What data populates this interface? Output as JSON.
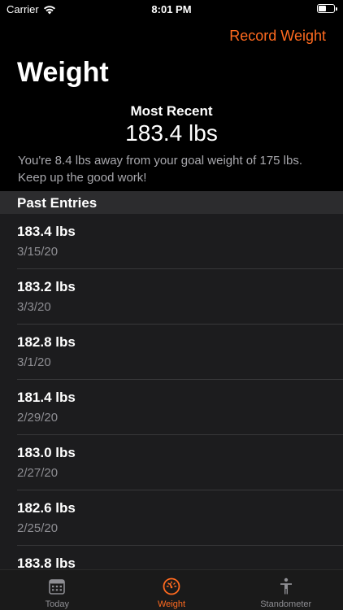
{
  "status_bar": {
    "carrier": "Carrier",
    "time": "8:01 PM"
  },
  "nav": {
    "record_button": "Record Weight",
    "title": "Weight"
  },
  "summary": {
    "most_recent_label": "Most Recent",
    "most_recent_value": "183.4 lbs",
    "goal_message": "You're 8.4 lbs away from your goal weight of 175 lbs. Keep up the good work!"
  },
  "past_entries": {
    "header": "Past Entries",
    "entries": [
      {
        "weight": "183.4 lbs",
        "date": "3/15/20"
      },
      {
        "weight": "183.2 lbs",
        "date": "3/3/20"
      },
      {
        "weight": "182.8 lbs",
        "date": "3/1/20"
      },
      {
        "weight": "181.4 lbs",
        "date": "2/29/20"
      },
      {
        "weight": "183.0 lbs",
        "date": "2/27/20"
      },
      {
        "weight": "182.6 lbs",
        "date": "2/25/20"
      },
      {
        "weight": "183.8 lbs",
        "date": ""
      }
    ]
  },
  "tab_bar": {
    "tabs": [
      {
        "label": "Today",
        "icon": "calendar-icon",
        "active": false
      },
      {
        "label": "Weight",
        "icon": "scale-gauge-icon",
        "active": true
      },
      {
        "label": "Standometer",
        "icon": "standing-person-icon",
        "active": false
      }
    ]
  },
  "colors": {
    "accent": "#ff6a1f",
    "background": "#000000",
    "list_background": "#1c1c1e",
    "section_header": "#2c2c2e",
    "secondary_text": "#8e8e93"
  }
}
